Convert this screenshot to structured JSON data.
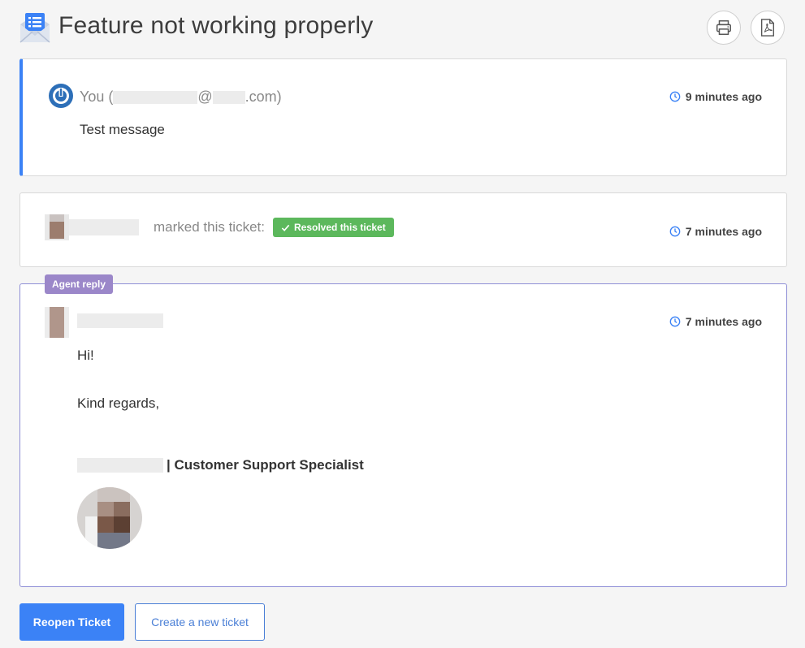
{
  "header": {
    "title": "Feature not working properly",
    "ticket_icon": "envelope-list-icon",
    "print_icon": "printer-icon",
    "pdf_icon": "pdf-file-icon"
  },
  "message": {
    "sender_prefix": "You (",
    "sender_at": "@",
    "sender_domain": ".com)",
    "time": "9 minutes ago",
    "body": "Test message",
    "avatar_icon": "power-icon"
  },
  "status_event": {
    "action_text": "marked this ticket:",
    "badge_label": "Resolved this ticket",
    "time": "7 minutes ago"
  },
  "agent_reply": {
    "tag": "Agent reply",
    "time": "7 minutes ago",
    "greeting": "Hi!",
    "closing": "Kind regards,",
    "signature_title": "| Customer Support Specialist"
  },
  "actions": {
    "reopen_label": "Reopen Ticket",
    "new_ticket_label": "Create a new ticket"
  },
  "colors": {
    "accent": "#3b82f6",
    "resolved": "#5cb85c",
    "agent_tag": "#9b87c9",
    "agent_border": "#8f8fd6"
  }
}
